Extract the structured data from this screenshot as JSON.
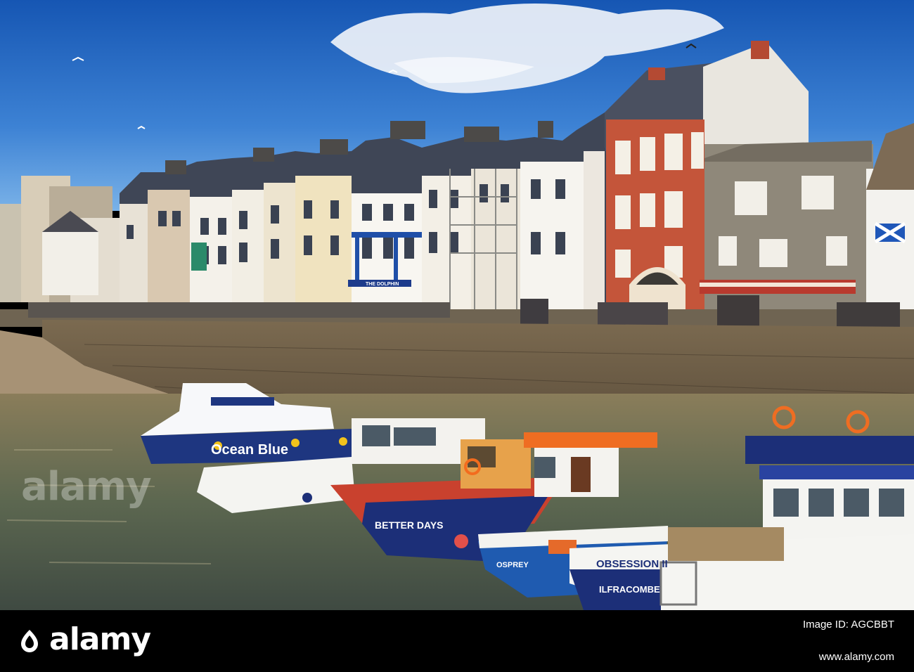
{
  "scene": {
    "subject": "harbour",
    "palette": {
      "sky": "#1a5fb8",
      "sky_light": "#5c9de0",
      "cloud": "#f3f5f8",
      "water": "#6b6a4e",
      "wall": "#6d5c43",
      "brick": "#c8573a",
      "navy": "#1c2f78",
      "orange": "#ef6d22"
    }
  },
  "boats": {
    "ocean_blue": "Ocean Blue",
    "better_days": "BETTER DAYS",
    "obsession": "OBSESSION II",
    "ilfracombe": "ILFRACOMBE",
    "osprey": "OSPREY"
  },
  "shop_signs": {
    "dolphin": "THE DOLPHIN"
  },
  "watermark": {
    "text": "alamy"
  },
  "footer": {
    "brand": "alamy",
    "image_id": "Image ID: AGCBBT",
    "website": "www.alamy.com"
  }
}
